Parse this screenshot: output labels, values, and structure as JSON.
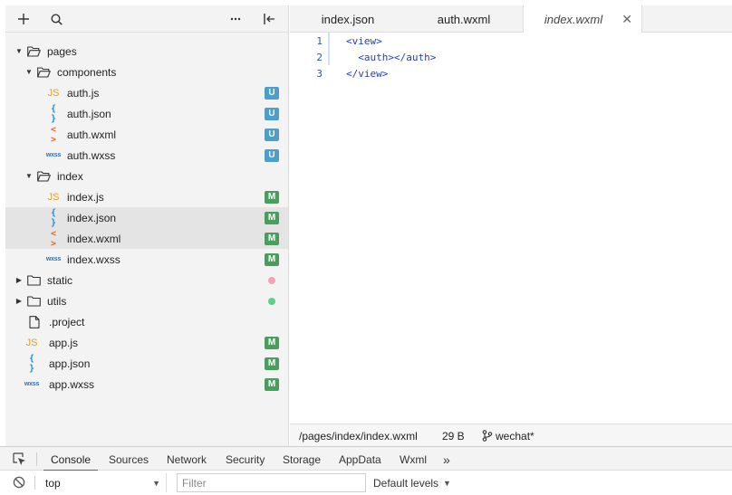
{
  "sidebar": {
    "toolbar": {
      "add": "+",
      "search": "⚲",
      "more": "···",
      "collapse": "⊫"
    },
    "tree": [
      {
        "label": "pages",
        "kind": "folder",
        "open": true,
        "depth": 0
      },
      {
        "label": "components",
        "kind": "folder",
        "open": true,
        "depth": 1
      },
      {
        "label": "auth.js",
        "kind": "js",
        "depth": 2,
        "badge": "U"
      },
      {
        "label": "auth.json",
        "kind": "json",
        "depth": 2,
        "badge": "U"
      },
      {
        "label": "auth.wxml",
        "kind": "wxml",
        "depth": 2,
        "badge": "U"
      },
      {
        "label": "auth.wxss",
        "kind": "wxss",
        "depth": 2,
        "badge": "U"
      },
      {
        "label": "index",
        "kind": "folder",
        "open": true,
        "depth": 1
      },
      {
        "label": "index.js",
        "kind": "js",
        "depth": 2,
        "badge": "M"
      },
      {
        "label": "index.json",
        "kind": "json",
        "depth": 2,
        "badge": "M",
        "selected": true
      },
      {
        "label": "index.wxml",
        "kind": "wxml",
        "depth": 2,
        "badge": "M",
        "selected": true
      },
      {
        "label": "index.wxss",
        "kind": "wxss",
        "depth": 2,
        "badge": "M"
      },
      {
        "label": "static",
        "kind": "folder",
        "open": false,
        "depth": 0,
        "dot": "#f2a3b8"
      },
      {
        "label": "utils",
        "kind": "folder",
        "open": false,
        "depth": 0,
        "dot": "#5fcf8c"
      },
      {
        "label": ".project",
        "kind": "plain",
        "depth": 0
      },
      {
        "label": "app.js",
        "kind": "js",
        "depth": 0,
        "badge": "M"
      },
      {
        "label": "app.json",
        "kind": "json",
        "depth": 0,
        "badge": "M"
      },
      {
        "label": "app.wxss",
        "kind": "wxss",
        "depth": 0,
        "badge": "M"
      }
    ],
    "icon_glyphs": {
      "js": "JS",
      "json": "{ }",
      "wxml": "< >",
      "wxss": "wxss"
    }
  },
  "editor": {
    "tabs": [
      {
        "label": "index.json",
        "active": false
      },
      {
        "label": "auth.wxml",
        "active": false
      },
      {
        "label": "index.wxml",
        "active": true
      }
    ],
    "close_glyph": "✕",
    "lines": [
      {
        "num": "1",
        "text": "<view>"
      },
      {
        "num": "2",
        "text": "  <auth></auth>"
      },
      {
        "num": "3",
        "text": "</view>"
      }
    ]
  },
  "status": {
    "path": "/pages/index/index.wxml",
    "size": "29 B",
    "branch_icon": "⚲",
    "branch": "wechat*"
  },
  "devtools": {
    "tabs": [
      "Console",
      "Sources",
      "Network",
      "Security",
      "Storage",
      "AppData",
      "Wxml"
    ],
    "active_tab": "Console",
    "overflow": "»",
    "context": "top",
    "filter_placeholder": "Filter",
    "levels": "Default levels"
  },
  "colors": {
    "badge_u": "#4d9ec8",
    "badge_m": "#4a9d5c",
    "accent": "#1a73e8"
  }
}
